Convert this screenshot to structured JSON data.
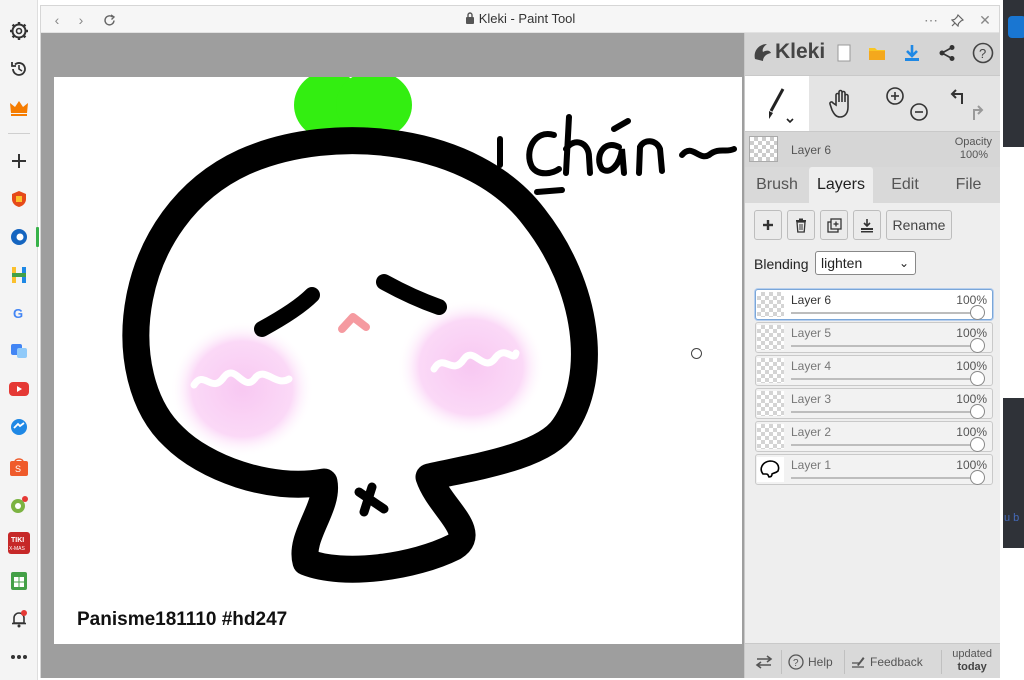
{
  "window": {
    "title": "Kleki - Paint Tool"
  },
  "app": {
    "logo_text": "Kleki",
    "accent_color": "#1e88e5"
  },
  "layer_info": {
    "name": "Layer 6",
    "opacity_label": "Opacity",
    "opacity_value": "100%"
  },
  "tabs": [
    {
      "label": "Brush"
    },
    {
      "label": "Layers"
    },
    {
      "label": "Edit"
    },
    {
      "label": "File"
    }
  ],
  "active_tab": "Layers",
  "layers_panel": {
    "rename_label": "Rename",
    "blending_label": "Blending",
    "blending_value": "lighten",
    "layers": [
      {
        "name": "Layer 6",
        "opacity": "100%",
        "selected": true
      },
      {
        "name": "Layer 5",
        "opacity": "100%",
        "selected": false
      },
      {
        "name": "Layer 4",
        "opacity": "100%",
        "selected": false
      },
      {
        "name": "Layer 3",
        "opacity": "100%",
        "selected": false
      },
      {
        "name": "Layer 2",
        "opacity": "100%",
        "selected": false
      },
      {
        "name": "Layer 1",
        "opacity": "100%",
        "selected": false
      }
    ]
  },
  "canvas": {
    "text_drawn": "Chán~",
    "watermark": "Panisme181110 #hd247"
  },
  "footer": {
    "help_label": "Help",
    "feedback_label": "Feedback",
    "updated_line1": "updated",
    "updated_line2": "today"
  },
  "peek": {
    "text": "u b"
  }
}
